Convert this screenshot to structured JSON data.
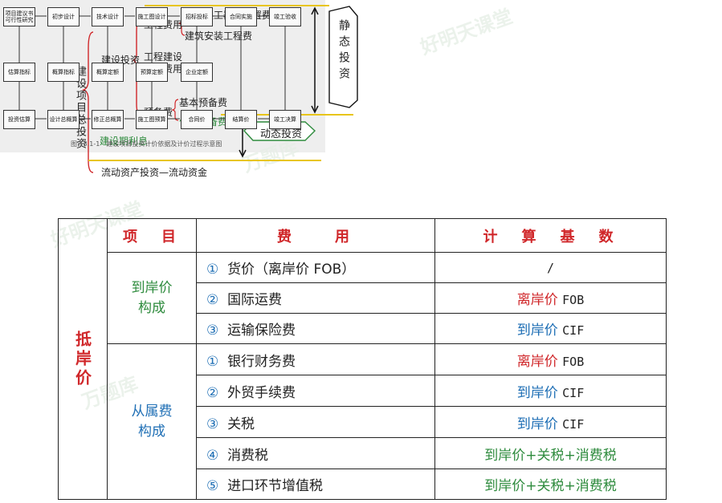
{
  "tree": {
    "root": "建设项目总投资",
    "l1_construction": "建设投资",
    "l1_interest": "建设期利息",
    "l1_working": "流动资产投资—流动资金",
    "eng_fee": "工程费用",
    "eng_fee_1": "设备及工器具购置费",
    "eng_fee_2": "建筑安装工程费",
    "other_fee_1": "工程建设",
    "other_fee_2": "其他费用",
    "reserve": "预备费",
    "reserve_basic": "基本预备费",
    "reserve_price": "价差预备费",
    "static_label": "静态投资",
    "dynamic_label": "动态投资"
  },
  "flow": {
    "row1": [
      "项目建议书可行性研究",
      "初步设计",
      "技术设计",
      "施工图设计",
      "招标投标",
      "合同实施",
      "竣工验收"
    ],
    "row2": [
      "估算指标",
      "概算指标",
      "概算定额",
      "预算定额",
      "企业定额"
    ],
    "row3": [
      "投资估算",
      "设计总概算",
      "修正总概算",
      "施工图预算",
      "合同价",
      "结算价",
      "竣工决算"
    ],
    "caption": "图 13.1-1　建设项目投资计价依据及计价过程示意图"
  },
  "table": {
    "headers": {
      "item": "项　目",
      "fee": "费　　用",
      "basis": "计　算　基　数"
    },
    "main_label": "抵岸价",
    "group1": "到岸价构成",
    "group2": "从属费构成",
    "rows": [
      {
        "num": "①",
        "name": "货价（离岸价 FOB）",
        "basis_cn": "",
        "basis_en": "/"
      },
      {
        "num": "②",
        "name": "国际运费",
        "basis_cn": "离岸价",
        "basis_en": "FOB"
      },
      {
        "num": "③",
        "name": "运输保险费",
        "basis_cn": "到岸价",
        "basis_en": "CIF"
      },
      {
        "num": "①",
        "name": "银行财务费",
        "basis_cn": "离岸价",
        "basis_en": "FOB"
      },
      {
        "num": "②",
        "name": "外贸手续费",
        "basis_cn": "到岸价",
        "basis_en": "CIF"
      },
      {
        "num": "③",
        "name": "关税",
        "basis_cn": "到岸价",
        "basis_en": "CIF"
      },
      {
        "num": "④",
        "name": "消费税",
        "basis_cn": "到岸价+关税+消费税",
        "basis_en": ""
      },
      {
        "num": "⑤",
        "name": "进口环节增值税",
        "basis_cn": "到岸价+关税+消费税",
        "basis_en": ""
      }
    ]
  },
  "watermarks": [
    "好明天课堂",
    "万题库"
  ]
}
